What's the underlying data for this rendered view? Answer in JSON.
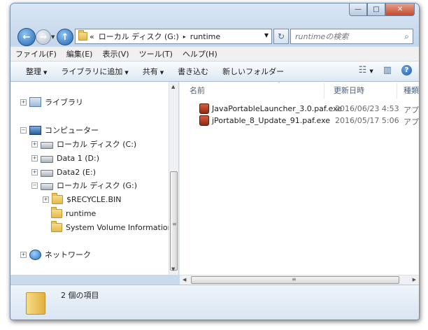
{
  "window": {
    "caption_buttons": {
      "minimize": "—",
      "maximize": "□",
      "close": "✕"
    }
  },
  "nav": {
    "address_prefix": "«",
    "crumbs": [
      "ローカル ディスク (G:)",
      "runtime"
    ],
    "crumb_separator": "▸",
    "search_placeholder": "runtimeの検索"
  },
  "menubar": [
    "ファイル(F)",
    "編集(E)",
    "表示(V)",
    "ツール(T)",
    "ヘルプ(H)"
  ],
  "toolbar": [
    {
      "label": "整理",
      "caret": "▼"
    },
    {
      "label": "ライブラリに追加",
      "caret": "▼"
    },
    {
      "label": "共有",
      "caret": "▼"
    },
    {
      "label": "書き込む",
      "caret": ""
    },
    {
      "label": "新しいフォルダー",
      "caret": ""
    }
  ],
  "toolbar_right": {
    "view": "☷",
    "view_caret": "▼",
    "preview": "▥",
    "help": "?"
  },
  "tree": [
    {
      "label": "ライブラリ",
      "icon": "library-icon",
      "expander": "+"
    },
    {
      "label": "コンピューター",
      "icon": "computer-icon",
      "expander": "−"
    },
    {
      "label": "ローカル ディスク (C:)",
      "icon": "drive-icon",
      "expander": "+"
    },
    {
      "label": "Data 1 (D:)",
      "icon": "drive-icon",
      "expander": "+"
    },
    {
      "label": "Data2 (E:)",
      "icon": "drive-icon",
      "expander": "+"
    },
    {
      "label": "ローカル ディスク (G:)",
      "icon": "drive-icon",
      "expander": "−"
    },
    {
      "label": "$RECYCLE.BIN",
      "icon": "folder-icon",
      "expander": "+"
    },
    {
      "label": "runtime",
      "icon": "folder-icon",
      "expander": ""
    },
    {
      "label": "System Volume Information",
      "icon": "folder-icon",
      "expander": ""
    },
    {
      "label": "ネットワーク",
      "icon": "network-icon",
      "expander": "+"
    }
  ],
  "list": {
    "sort_indicator": "˄",
    "columns": [
      "名前",
      "更新日時",
      "種類"
    ],
    "files": [
      {
        "name": "JavaPortableLauncher_3.0.paf.exe",
        "date": "2016/06/23 4:53",
        "type": "アプリ"
      },
      {
        "name": "jPortable_8_Update_91.paf.exe",
        "date": "2016/05/17 5:06",
        "type": "アプリ"
      }
    ]
  },
  "scroll": {
    "up": "▲",
    "down": "▼",
    "left": "◀",
    "right": "▶",
    "grip": "≡",
    "grip_h": "⦀"
  },
  "status": {
    "item_count": "2 個の項目"
  }
}
